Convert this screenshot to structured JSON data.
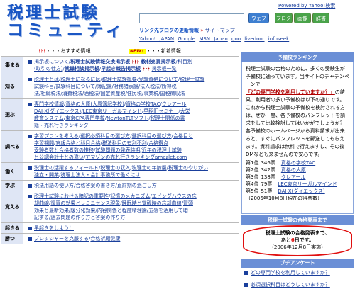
{
  "header": {
    "logo_line1": "税理士試験",
    "logo_line2": "コミュニティ",
    "yahoo_link": "Powered by Yahoo!検索",
    "search_placeholder": "",
    "btn_web": "ウェブ",
    "btn_blog": "ブログ",
    "btn_image": "画像",
    "btn_dict": "辞書",
    "links_heading": "リンク先ブログの更新情報",
    "links_arrow": "»",
    "sitemap": "サイトマップ",
    "portal_links": [
      "Yahoo! JAPAN",
      "Google",
      "MSN Japan",
      "goo",
      "livedoor",
      "infoseek"
    ]
  },
  "recommend_bar": {
    "arrows": "ﾄﾄﾄ",
    "left_title": "・・・おすすめ情報",
    "new_badge": "NEW！",
    "right_title": "・・・新着情報"
  },
  "sections": [
    {
      "cat": "集まる",
      "lines": [
        [
          {
            "t": "掲示板について",
            " s": "n"
          },
          {
            "t": "/"
          },
          {
            "t": "税理士試験情報交換掲示板",
            "s": "b"
          },
          {
            "t": " ﾄﾄﾄ ",
            "s": "r"
          },
          {
            "t": "教材売買掲示板",
            "s": "b"
          },
          {
            "t": "/"
          },
          {
            "t": "科目別"
          }
        ],
        [
          {
            "t": "(取引の仕方)"
          },
          {
            "t": "/"
          },
          {
            "t": "就職相談掲示板",
            "s": "b"
          },
          {
            "t": "/"
          },
          {
            "t": "早起き報告掲示板",
            "s": "b"
          },
          {
            "t": " ﾄﾄﾄ ",
            "s": "r"
          },
          {
            "t": "掲示板一覧"
          }
        ]
      ]
    },
    {
      "cat": "知る",
      "lines": [
        [
          {
            "t": "税理士とは"
          },
          {
            "t": "/"
          },
          {
            "t": "税理士になるには"
          },
          {
            "t": "/"
          },
          {
            "t": "税理士試験概要"
          },
          {
            "t": "/"
          },
          {
            "t": "受験資格について"
          },
          {
            "t": "/"
          },
          {
            "t": "税理士試験"
          }
        ],
        [
          {
            "t": "試験科目"
          },
          {
            "t": "/"
          },
          {
            "t": "試験科目について"
          },
          {
            "t": "/"
          },
          {
            "t": "簿記論"
          },
          {
            "t": "/"
          },
          {
            "t": "財務諸表論"
          },
          {
            "t": "/"
          },
          {
            "t": "法人税法"
          },
          {
            "t": "/"
          },
          {
            "t": "所得税"
          }
        ],
        [
          {
            "t": "法"
          },
          {
            "t": "/"
          },
          {
            "t": "相続税法"
          },
          {
            "t": "/"
          },
          {
            "t": "消費税法"
          },
          {
            "t": "/"
          },
          {
            "t": "酒税法"
          },
          {
            "t": "/"
          },
          {
            "t": "固定資産税"
          },
          {
            "t": "/"
          },
          {
            "t": "住民税"
          },
          {
            "t": "/"
          },
          {
            "t": "事業税"
          },
          {
            "t": "/"
          },
          {
            "t": "国税徴収法"
          }
        ]
      ]
    },
    {
      "cat": "選ぶ",
      "lines": [
        [
          {
            "t": "専門学校情報"
          },
          {
            "t": "/"
          },
          {
            "t": "資格の大原(大原簿記学校)"
          },
          {
            "t": "/"
          },
          {
            "t": "資格の学校TAC"
          },
          {
            "t": "/"
          },
          {
            "t": "クレアール"
          }
        ],
        [
          {
            "t": "DAI-X(ダイエックス)"
          },
          {
            "t": "/"
          },
          {
            "t": "LEC東京リーガルマインド"
          },
          {
            "t": "/"
          },
          {
            "t": "早稲田セミナー"
          },
          {
            "t": "/"
          },
          {
            "t": "大栄"
          }
        ],
        [
          {
            "t": "教育システム"
          },
          {
            "t": "/"
          },
          {
            "t": "東京CPA専門学校"
          },
          {
            "t": "/"
          },
          {
            "t": "NewtonTLTソフト"
          },
          {
            "t": "/"
          },
          {
            "t": "税理士関係の書"
          }
        ],
        [
          {
            "t": "籍・売れ行きランキング"
          }
        ]
      ]
    },
    {
      "cat": "調べる",
      "lines": [
        [
          {
            "t": "学習プランを考える"
          },
          {
            "t": "/"
          },
          {
            "t": "選択必須科目の選び方"
          },
          {
            "t": "/"
          },
          {
            "t": "選択科目の選び方"
          },
          {
            "t": "/"
          },
          {
            "t": "合格目と"
          }
        ],
        [
          {
            "t": "学習期間"
          },
          {
            "t": "/"
          },
          {
            "t": "官報合格と科目合格"
          },
          {
            "t": "/"
          },
          {
            "t": "税法科目の有利不利"
          },
          {
            "t": "/"
          },
          {
            "t": "合格得点"
          }
        ],
        [
          {
            "t": "受験者数と合格者数の推移"
          },
          {
            "t": "/"
          },
          {
            "t": "試験問題の発表時期"
          },
          {
            "t": "/"
          },
          {
            "t": "近年の税理士試験"
          }
        ],
        [
          {
            "t": "と公認会計士との違い"
          },
          {
            "t": "/"
          },
          {
            "t": "アマゾンの売れ行きランキングamazlet.com"
          }
        ]
      ]
    },
    {
      "cat": "働く",
      "lines": [
        [
          {
            "t": "税理士の活躍するフィールド"
          },
          {
            "t": "/"
          },
          {
            "t": "税理士の収入"
          },
          {
            "t": "/"
          },
          {
            "t": "税理士の年齢層"
          },
          {
            "t": "/"
          },
          {
            "t": "税理士のやりがい"
          }
        ],
        [
          {
            "t": "独立・開業"
          },
          {
            "t": "/"
          },
          {
            "t": "税理士法人・会計事務所で働くには"
          }
        ]
      ]
    },
    {
      "cat": "学ぶ",
      "lines": [
        [
          {
            "t": "税法用語の使い方"
          },
          {
            "t": "/"
          },
          {
            "t": "合格答案の書き方"
          },
          {
            "t": "/"
          },
          {
            "t": "直前期の過ごし方"
          }
        ]
      ]
    },
    {
      "cat": "覚える",
      "lines": [
        [
          {
            "t": "税理士試験における暗記の重要性"
          },
          {
            "t": "/"
          },
          {
            "t": "記憶のメカニズム"
          },
          {
            "t": "/"
          },
          {
            "t": "エビングハウスの忘"
          }
        ],
        [
          {
            "t": "却曲線"
          },
          {
            "t": "/"
          },
          {
            "t": "復習の効果とレミニセンス現象"
          },
          {
            "t": "/"
          },
          {
            "t": "睡眠時と覚醒時の忘却曲線"
          },
          {
            "t": "/"
          },
          {
            "t": "冒頭"
          }
        ],
        [
          {
            "t": "効果と最新効果"
          },
          {
            "t": "/"
          },
          {
            "t": "緩分化効果"
          },
          {
            "t": "/"
          },
          {
            "t": "内容関係と程度精理論"
          },
          {
            "t": "/"
          },
          {
            "t": "五感を活用して暗"
          }
        ],
        [
          {
            "t": "記する"
          },
          {
            "t": "/"
          },
          {
            "t": "過去問題の作り方と答案の作り方"
          }
        ]
      ]
    },
    {
      "cat": "起きる",
      "lines": [
        [
          {
            "t": "早起きをしよう！"
          }
        ]
      ]
    },
    {
      "cat": "勝つ",
      "lines": [
        [
          {
            "t": "プレッシャーを克服する"
          },
          {
            "t": "/"
          },
          {
            "t": "合格祈願健康"
          }
        ]
      ]
    }
  ],
  "ranking": {
    "heading": "予備校ランキング",
    "intro_pre": "税理士試験の合格のために、多くの受験生が予備校に通っています。当サイトのチャチンペーンで",
    "intro_link": "「どの専門学校を利用していますか？」",
    "intro_post": "の結果、利用者の多い予備校は以下の通りです。これから税理士試験の予備校を検討される方は、ぜひ一度、各予備校のパンフレットを請求をして比較検討してはいかがでしょうか？各予備校のホームページから資料請求が出来ると、すぐにパンフレットを郵送してもらえます。資料請求は無料で行えますし、その後DMなども来ませんので安心です。",
    "entries": [
      {
        "rank": "第1位",
        "votes": "346票",
        "school": "資格の学校TAC"
      },
      {
        "rank": "第2位",
        "votes": "342票",
        "school": "資格の大原"
      },
      {
        "rank": "第3位",
        "votes": "138票",
        "school": "クレアール"
      },
      {
        "rank": "第4位",
        "votes": "79票",
        "school": "LEC東京リーガルマインド"
      },
      {
        "rank": "第5位",
        "votes": "51票",
        "school": "DAI-X(ダイエックス)"
      }
    ],
    "footnote": "（2006年10月8日現在の得票数）"
  },
  "countdown": {
    "heading": "税理士試験の合格発表まで",
    "line1": "税理士試験の合格発表まで、",
    "prefix": "あと",
    "days": "6",
    "suffix": "日です。",
    "note": "（2006年12月8日実施）"
  },
  "survey": {
    "heading": "ブチアンケート",
    "items": [
      "どの専門学校を利用していますか？",
      "必須選択科目はどうしていますか？"
    ]
  }
}
